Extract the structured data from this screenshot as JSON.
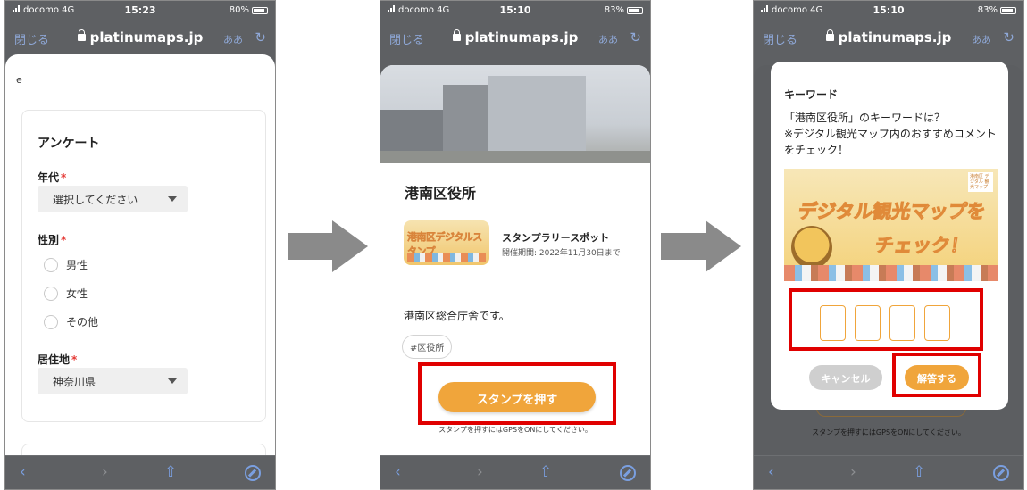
{
  "statusbars": [
    {
      "carrier": "docomo 4G",
      "time": "15:23",
      "battery": "80%"
    },
    {
      "carrier": "docomo 4G",
      "time": "15:10",
      "battery": "83%"
    },
    {
      "carrier": "docomo 4G",
      "time": "15:10",
      "battery": "83%"
    }
  ],
  "browser": {
    "close_label": "閉じる",
    "domain": "platinumaps.jp",
    "text_size_label": "ああ",
    "reload_glyph": "↻",
    "back_glyph": "‹",
    "forward_glyph": "›",
    "share_glyph": "⇧"
  },
  "survey": {
    "stub_text": "e",
    "title": "アンケート",
    "age_label": "年代",
    "age_value": "選択してください",
    "gender_label": "性別",
    "gender_options": [
      "男性",
      "女性",
      "その他"
    ],
    "residence_label": "居住地",
    "residence_value": "神奈川県",
    "required_mark": "*"
  },
  "spot": {
    "name": "港南区役所",
    "thumb_text": "港南区デジタルスタンプ",
    "category": "スタンプラリースポット",
    "period": "開催期間: 2022年11月30日まで",
    "description": "港南区総合庁舎です。",
    "tag": "#区役所",
    "stamp_button": "スタンプを押す",
    "gps_note": "スタンプを押すにはGPSをONにしてください。"
  },
  "keyword_modal": {
    "title": "キーワード",
    "question": "「港南区役所」のキーワードは？\n※デジタル観光マップ内のおすすめコメントをチェック！",
    "banner_line1": "デジタル観光マップを",
    "banner_line2": "チェック！",
    "banner_logo": "港南区 デジタル 観光マップ",
    "answer_slots": 4,
    "cancel_button": "キャンセル",
    "answer_button": "解答する"
  },
  "colors": {
    "accent": "#f0a53b",
    "highlight": "#e00000",
    "required": "#e53935",
    "arrow": "#8a8a8a"
  }
}
